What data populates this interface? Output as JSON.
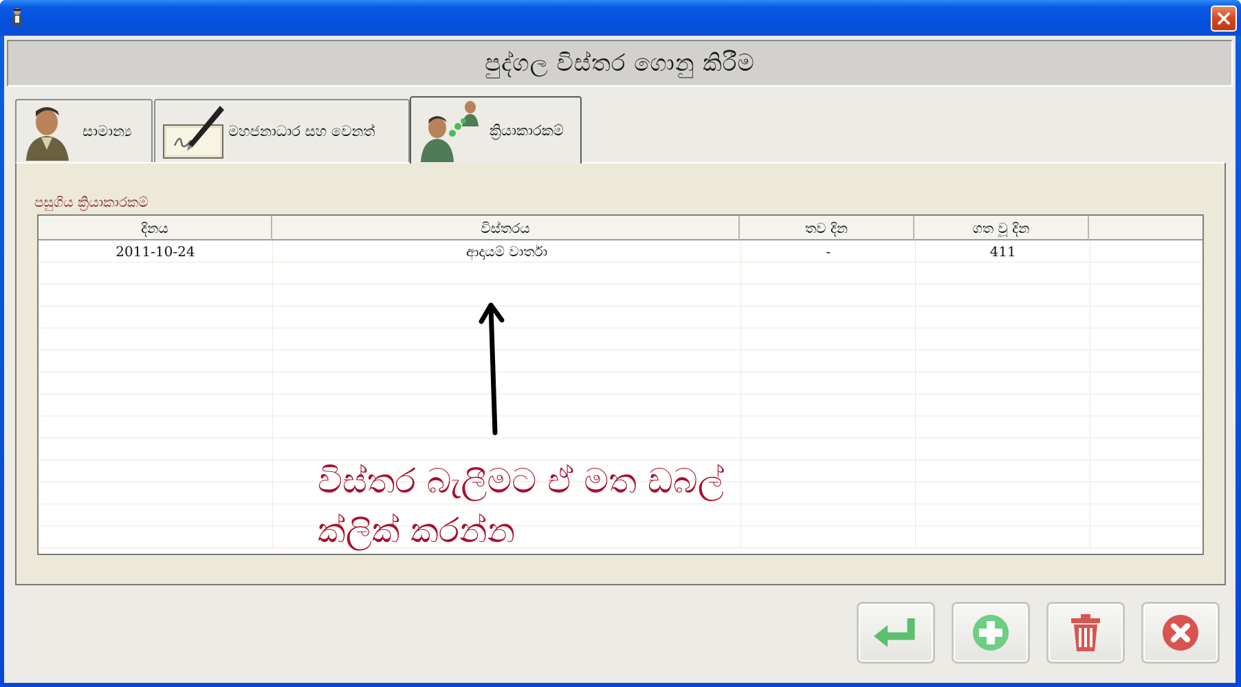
{
  "window": {
    "title": "",
    "header_title": "පුද්ගල විස්තර ගොනු කිරීම"
  },
  "tabs": [
    {
      "label": "සාමාන්‍ය",
      "icon": "person-icon"
    },
    {
      "label": "මහජනාධාර සහ වෙනත්",
      "icon": "signature-pen-icon"
    },
    {
      "label": "ක්‍රියාකාරකම්",
      "icon": "people-network-icon"
    }
  ],
  "active_tab": 2,
  "activities": {
    "group_label": "පසුගිය ක්‍රියාකාරකම්",
    "columns": [
      "දිනය",
      "විස්තරය",
      "තව දින",
      "ගත වූ දින",
      ""
    ],
    "rows": [
      [
        "2011-10-24",
        "ආදායම් වාර්තා",
        "-",
        "411",
        ""
      ]
    ]
  },
  "annotation": {
    "line1": "විස්තර බැලීමට ඒ මත ඩබල්",
    "line2": "ක්ලික් කරන්න"
  },
  "buttons": [
    {
      "name": "enter-button",
      "icon": "enter-arrow-icon"
    },
    {
      "name": "add-button",
      "icon": "plus-icon"
    },
    {
      "name": "delete-button",
      "icon": "trash-icon"
    },
    {
      "name": "cancel-button",
      "icon": "close-circle-icon"
    }
  ],
  "colors": {
    "titlebar": "#0a5ae6",
    "annotation": "#a8102c",
    "group_label": "#8b2d2d",
    "enter_icon": "#5bbf6e",
    "add_icon": "#6ccf84",
    "delete_icon": "#d9534f",
    "cancel_icon": "#d9534f"
  }
}
